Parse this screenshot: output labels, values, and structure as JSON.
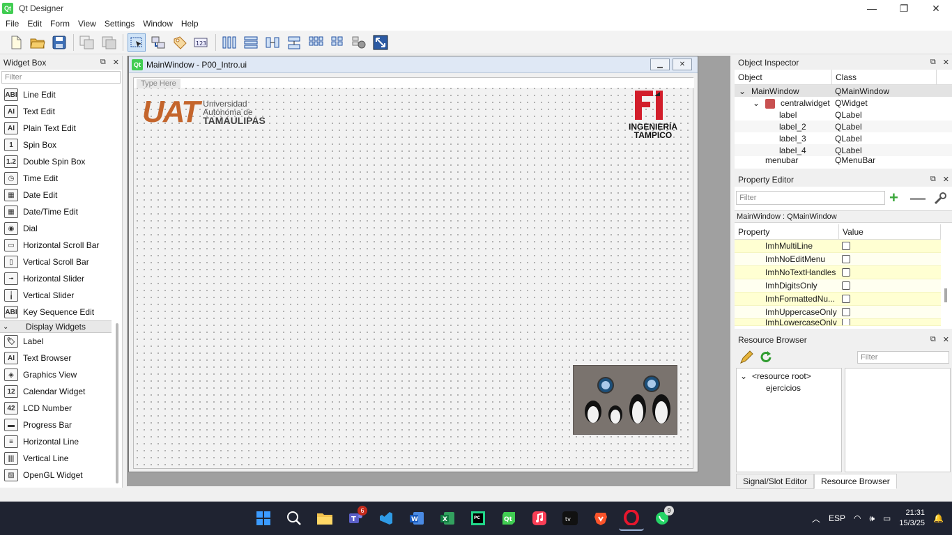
{
  "window": {
    "title": "Qt Designer",
    "app_icon": "Qt",
    "controls": [
      "—",
      "❐",
      "✕"
    ]
  },
  "menu": [
    "File",
    "Edit",
    "Form",
    "View",
    "Settings",
    "Window",
    "Help"
  ],
  "widget_box": {
    "title": "Widget Box",
    "filter_placeholder": "Filter",
    "items_a": [
      {
        "label": "Line Edit",
        "icon": "ABI"
      },
      {
        "label": "Text Edit",
        "icon": "AI"
      },
      {
        "label": "Plain Text Edit",
        "icon": "AI"
      },
      {
        "label": "Spin Box",
        "icon": "1"
      },
      {
        "label": "Double Spin Box",
        "icon": "1.2"
      },
      {
        "label": "Time Edit",
        "icon": "◷"
      },
      {
        "label": "Date Edit",
        "icon": "▦"
      },
      {
        "label": "Date/Time Edit",
        "icon": "▦"
      },
      {
        "label": "Dial",
        "icon": "◉"
      },
      {
        "label": "Horizontal Scroll Bar",
        "icon": "▭"
      },
      {
        "label": "Vertical Scroll Bar",
        "icon": "▯"
      },
      {
        "label": "Horizontal Slider",
        "icon": "╼"
      },
      {
        "label": "Vertical Slider",
        "icon": "╽"
      },
      {
        "label": "Key Sequence Edit",
        "icon": "ABI"
      }
    ],
    "category": "Display Widgets",
    "items_b": [
      {
        "label": "Label",
        "icon": "🏷"
      },
      {
        "label": "Text Browser",
        "icon": "AI"
      },
      {
        "label": "Graphics View",
        "icon": "◈"
      },
      {
        "label": "Calendar Widget",
        "icon": "12"
      },
      {
        "label": "LCD Number",
        "icon": "42"
      },
      {
        "label": "Progress Bar",
        "icon": "▬"
      },
      {
        "label": "Horizontal Line",
        "icon": "≡"
      },
      {
        "label": "Vertical Line",
        "icon": "|||"
      },
      {
        "label": "OpenGL Widget",
        "icon": "▨"
      }
    ]
  },
  "subwindow": {
    "title": "MainWindow - P00_Intro.ui",
    "type_here": "Type Here",
    "logo_uat": {
      "big": "UAT",
      "line1": "Universidad",
      "line2": "Autónoma de",
      "line3": "TAMAULIPAS"
    },
    "logo_fi": {
      "line1": "INGENIERÍA",
      "line2": "TAMPICO"
    }
  },
  "object_inspector": {
    "title": "Object Inspector",
    "columns": [
      "Object",
      "Class"
    ],
    "rows": [
      {
        "object": "MainWindow",
        "class": "QMainWindow",
        "indent": 0,
        "expander": "⌄"
      },
      {
        "object": "centralwidget",
        "class": "QWidget",
        "indent": 1,
        "expander": "⌄"
      },
      {
        "object": "label",
        "class": "QLabel",
        "indent": 2,
        "expander": ""
      },
      {
        "object": "label_2",
        "class": "QLabel",
        "indent": 2,
        "expander": ""
      },
      {
        "object": "label_3",
        "class": "QLabel",
        "indent": 2,
        "expander": ""
      },
      {
        "object": "label_4",
        "class": "QLabel",
        "indent": 2,
        "expander": ""
      },
      {
        "object": "menubar",
        "class": "QMenuBar",
        "indent": 1,
        "expander": ""
      }
    ]
  },
  "property_editor": {
    "title": "Property Editor",
    "filter_placeholder": "Filter",
    "object_line": "MainWindow : QMainWindow",
    "columns": [
      "Property",
      "Value"
    ],
    "rows": [
      {
        "name": "ImhMultiLine"
      },
      {
        "name": "ImhNoEditMenu"
      },
      {
        "name": "ImhNoTextHandles"
      },
      {
        "name": "ImhDigitsOnly"
      },
      {
        "name": "ImhFormattedNu..."
      },
      {
        "name": "ImhUppercaseOnly"
      },
      {
        "name": "ImhLowercaseOnly"
      }
    ]
  },
  "resource_browser": {
    "title": "Resource Browser",
    "filter_placeholder": "Filter",
    "tree": [
      "<resource root>",
      "ejercicios"
    ],
    "tabs": [
      "Signal/Slot Editor",
      "Resource Browser"
    ]
  },
  "taskbar": {
    "badges": {
      "teams": "6",
      "whatsapp": "9"
    },
    "language": "ESP",
    "time": "21:31",
    "date": "15/3/25"
  }
}
